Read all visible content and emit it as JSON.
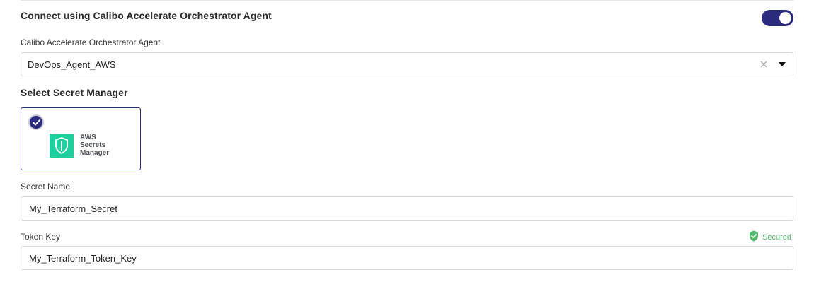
{
  "connect": {
    "title": "Connect using Calibo Accelerate Orchestrator Agent",
    "toggle_on": true
  },
  "agent_select": {
    "label": "Calibo Accelerate Orchestrator Agent",
    "value": "DevOps_Agent_AWS"
  },
  "secret_manager": {
    "title": "Select Secret Manager",
    "selected": true,
    "logo_lines": [
      "AWS",
      "Secrets",
      "Manager"
    ]
  },
  "secret_name": {
    "label": "Secret Name",
    "value": "My_Terraform_Secret"
  },
  "token_key": {
    "label": "Token Key",
    "value": "My_Terraform_Token_Key",
    "status": "Secured"
  },
  "colors": {
    "accent": "#2c2c7e",
    "aws_green": "#1fcf9e",
    "secured_green": "#53b86b"
  },
  "icons": [
    "close-icon",
    "caret-down-icon",
    "check-icon",
    "shield-icon",
    "shield-check-icon"
  ]
}
